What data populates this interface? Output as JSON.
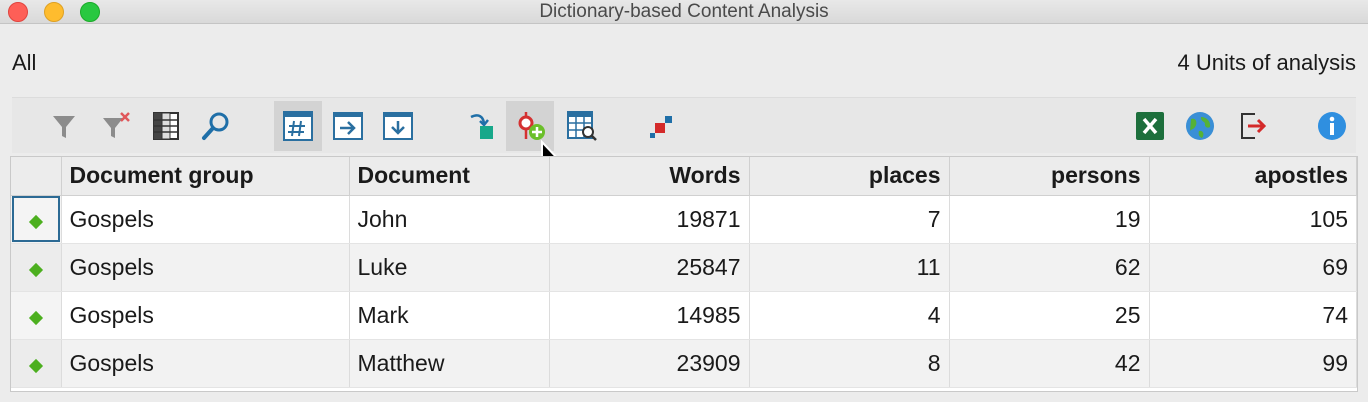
{
  "window": {
    "title": "Dictionary-based Content Analysis"
  },
  "info": {
    "filter_label": "All",
    "units_label": "4 Units of analysis"
  },
  "toolbar": {
    "buttons": [
      {
        "name": "filter-icon"
      },
      {
        "name": "clear-filter-icon"
      },
      {
        "name": "columns-icon"
      },
      {
        "name": "search-icon"
      },
      {
        "name": "frequency-table-icon",
        "active": true
      },
      {
        "name": "export-right-icon"
      },
      {
        "name": "export-down-icon"
      },
      {
        "name": "transform-icon"
      },
      {
        "name": "add-code-icon",
        "active": true
      },
      {
        "name": "table-search-icon"
      },
      {
        "name": "codeline-icon"
      },
      {
        "name": "excel-icon"
      },
      {
        "name": "web-icon"
      },
      {
        "name": "export-icon"
      },
      {
        "name": "info-icon"
      }
    ]
  },
  "table": {
    "columns": [
      "",
      "Document group",
      "Document",
      "Words",
      "places",
      "persons",
      "apostles"
    ],
    "rows": [
      {
        "group": "Gospels",
        "document": "John",
        "words": "19871",
        "places": "7",
        "persons": "19",
        "apostles": "105"
      },
      {
        "group": "Gospels",
        "document": "Luke",
        "words": "25847",
        "places": "11",
        "persons": "62",
        "apostles": "69"
      },
      {
        "group": "Gospels",
        "document": "Mark",
        "words": "14985",
        "places": "4",
        "persons": "25",
        "apostles": "74"
      },
      {
        "group": "Gospels",
        "document": "Matthew",
        "words": "23909",
        "places": "8",
        "persons": "42",
        "apostles": "99"
      }
    ]
  },
  "colors": {
    "marker": "#4caf1f",
    "selection": "#2c6a94",
    "accent_blue": "#1f6fa8"
  }
}
